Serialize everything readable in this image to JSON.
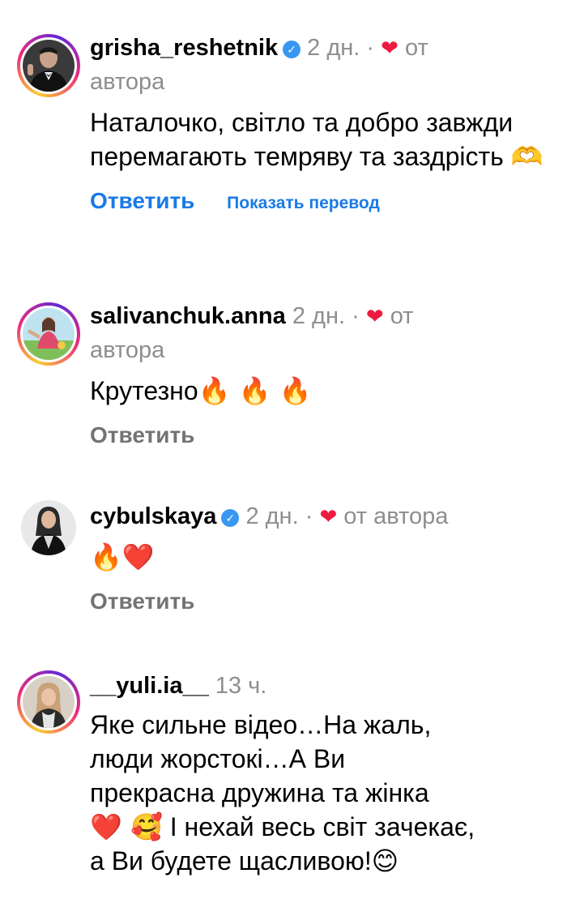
{
  "comments": [
    {
      "username": "grisha_reshetnik",
      "verified": true,
      "time": "2 дн.",
      "sep": "·",
      "liked_label": "от",
      "liked_label_2": "автора",
      "text": "Наталочко, світло та добро завжди перемагають темряву та заздрість",
      "emoji": "🫶",
      "reply": "Ответить",
      "translate": "Показать перевод",
      "avatar_icon": "man-in-tuxedo-avatar"
    },
    {
      "username": "salivanchuk.anna",
      "verified": false,
      "time": "2 дн.",
      "sep": "·",
      "liked_label": "от",
      "liked_label_2": "автора",
      "text": "Крутезно",
      "emoji": "🔥 🔥 🔥",
      "reply": "Ответить",
      "avatar_icon": "woman-outdoors-avatar"
    },
    {
      "username": "cybulskaya",
      "verified": true,
      "time": "2 дн.",
      "sep": "·",
      "liked_label": "от автора",
      "text": "",
      "emoji": "🔥❤️",
      "reply": "Ответить",
      "avatar_icon": "woman-in-black-avatar"
    },
    {
      "username": "__yuli.ia__",
      "verified": false,
      "time": "13 ч.",
      "text_line1": "Яке сильне відео…На жаль,",
      "text_line2": "люди жорстокі…А Ви",
      "text_line3": "прекрасна дружина та жінка",
      "text_emoji": "❤️ 🥰",
      "text_line4": "І нехай весь світ зачекає,",
      "text_line5": "а Ви будете щасливою!",
      "text_end_emoji": "😊",
      "avatar_icon": "woman-portrait-avatar"
    }
  ],
  "colors": {
    "reply_blue": "#1a7ae6",
    "meta_gray": "#8e8e8e",
    "heart": "#ed1b40",
    "verified": "#3897f0"
  }
}
